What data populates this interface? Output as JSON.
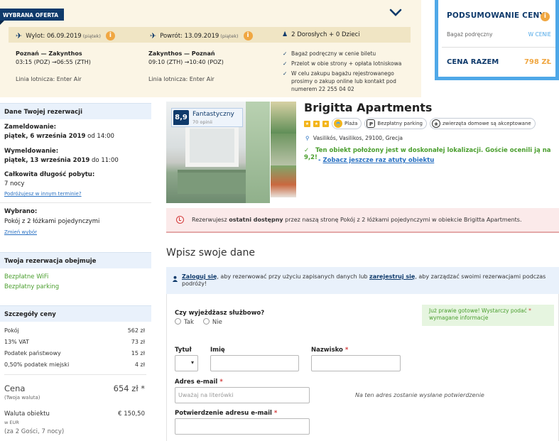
{
  "offer": {
    "badge": "WYBRANA OFERTA",
    "outbound_header": "Wylot: 06.09.2019",
    "outbound_small": "(piątek)",
    "return_header": "Powrót: 13.09.2019",
    "return_small": "(piątek)",
    "passengers": "2 Dorosłych + 0 Dzieci",
    "outbound_route": "Poznań — Zakynthos",
    "outbound_times": "03:15 (POZ) →06:55 (ZTH)",
    "outbound_airline": "Linia lotnicza: Enter Air",
    "return_route": "Zakynthos — Poznań",
    "return_times": "09:10 (ZTH) →10:40 (POZ)",
    "return_airline": "Linia lotnicza: Enter Air",
    "inclusions": [
      "Bagaż podręczny w cenie biletu",
      "Przelot w obie strony + opłata lotniskowa",
      "W celu zakupu bagażu rejestrowanego prosimy o zakup online lub kontakt pod numerem 22 255 04 02"
    ]
  },
  "price_summary": {
    "title": "PODSUMOWANIE CENY",
    "hand_luggage_label": "Bagaż podręczny",
    "hand_luggage_value": "W CENIE",
    "total_label": "CENA RAZEM",
    "total_value": "798 ZŁ"
  },
  "sidebar": {
    "booking_header": "Dane Twojej rezerwacji",
    "checkin_label": "Zameldowanie:",
    "checkin_date": "piątek, 6 września 2019",
    "checkin_time": "od 14:00",
    "checkout_label": "Wymeldowanie:",
    "checkout_date": "piątek, 13 września 2019",
    "checkout_time": "do 11:00",
    "stay_label": "Całkowita długość pobytu:",
    "stay_value": "7 nocy",
    "other_date_link": "Podróżujesz w innym terminie?",
    "chosen_label": "Wybrano:",
    "chosen_value": "Pokój z 2 łóżkami pojedynczymi",
    "change_link": "Zmień wybór",
    "includes_header": "Twoja rezerwacja obejmuje",
    "includes": [
      "Bezpłatne WiFi",
      "Bezpłatny parking"
    ],
    "price_header": "Szczegóły ceny",
    "price_rows": [
      {
        "label": "Pokój",
        "value": "562 zł"
      },
      {
        "label": "13% VAT",
        "value": "73 zł"
      },
      {
        "label": "Podatek państwowy",
        "value": "15 zł"
      },
      {
        "label": "0,50% podatek miejski",
        "value": "4 zł"
      }
    ],
    "price_label": "Cena",
    "price_sub": "(Twoja waluta)",
    "price_value": "654 zł *",
    "currency_label": "Waluta obiektu",
    "currency_sub": "w EUR",
    "currency_value": "€ 150,50",
    "guests_note": "(za 2 Gości, 7 nocy)"
  },
  "hotel": {
    "score": "8,9",
    "score_label": "Fantastyczny",
    "reviews": "70 opinii",
    "name": "Brigitta Apartments",
    "amenities": [
      "Plaża",
      "Bezpłatny parking",
      "zwierzęta domowe są akceptowane"
    ],
    "address": "Vasilikós, Vasilikos, 29100, Grecja",
    "location_note": "Ten obiekt położony jest w doskonałej lokalizacji. Goście ocenili ją na 9,2!",
    "location_link_prefix": "-",
    "location_link": "Zobacz jeszcze raz atuty obiektu"
  },
  "alert": {
    "prefix": "Rezerwujesz",
    "strong": "ostatni dostępny",
    "suffix": "przez naszą stronę Pokój z 2 łóżkami pojedynczymi w obiekcie Brigitta Apartments."
  },
  "form": {
    "title": "Wpisz swoje dane",
    "login_link": "Zaloguj się",
    "login_mid": ", aby rezerwować przy użyciu zapisanych danych lub",
    "register_link": "zarejestruj się",
    "login_suffix": ", aby zarządzać swoimi rezerwacjami podczas podróży!",
    "business_question": "Czy wyjeżdżasz służbowo?",
    "yes": "Tak",
    "no": "Nie",
    "ready_note": "Już prawie gotowe! Wystarczy podać",
    "ready_note_2": "wymagane informacje",
    "title_label": "Tytuł",
    "first_name_label": "Imię",
    "last_name_label": "Nazwisko",
    "email_label": "Adres e-mail",
    "email_placeholder": "Uważaj na literówki",
    "email_note": "Na ten adres zostanie wysłane potwierdzenie",
    "email_confirm_label": "Potwierdzenie adresu e-mail",
    "required_mark": "*"
  },
  "colors": {
    "navy": "#0f3a6b",
    "accent_blue": "#4fa8e8",
    "orange": "#f0a742",
    "green": "#4a9e2e",
    "alert_red": "#d43b3b"
  }
}
